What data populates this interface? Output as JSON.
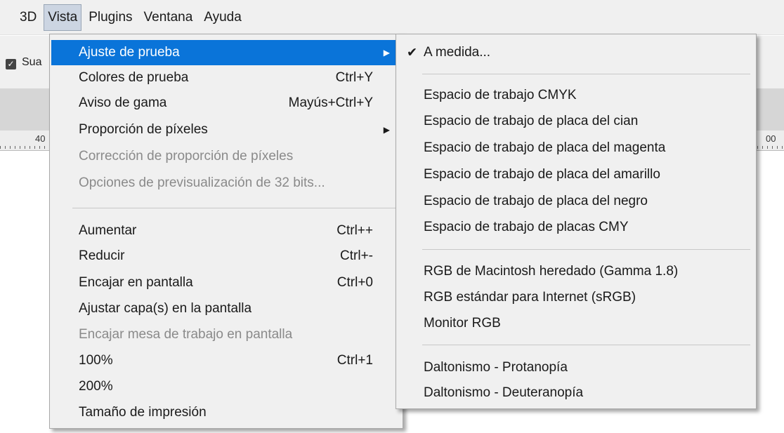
{
  "menubar": {
    "items": [
      "3D",
      "Vista",
      "Plugins",
      "Ventana",
      "Ayuda"
    ],
    "active": "Vista"
  },
  "options_bar": {
    "label": "Sua"
  },
  "ruler": {
    "left_number": "40",
    "right_number": "00"
  },
  "view_menu": {
    "items": [
      {
        "label": "Ajuste de prueba",
        "shortcut": "",
        "submenu": true,
        "state": "highlighted"
      },
      {
        "label": "Colores de prueba",
        "shortcut": "Ctrl+Y"
      },
      {
        "label": "Aviso de gama",
        "shortcut": "Mayús+Ctrl+Y"
      },
      {
        "label": "Proporción de píxeles",
        "shortcut": "",
        "submenu": true
      },
      {
        "label": "Corrección de proporción de píxeles",
        "shortcut": "",
        "state": "disabled"
      },
      {
        "label": "Opciones de previsualización de 32 bits...",
        "shortcut": "",
        "state": "disabled"
      },
      {
        "label": "Aumentar",
        "shortcut": "Ctrl++"
      },
      {
        "label": "Reducir",
        "shortcut": "Ctrl+-"
      },
      {
        "label": "Encajar en pantalla",
        "shortcut": "Ctrl+0"
      },
      {
        "label": "Ajustar capa(s) en la pantalla",
        "shortcut": ""
      },
      {
        "label": "Encajar mesa de trabajo en pantalla",
        "shortcut": "",
        "state": "disabled"
      },
      {
        "label": "100%",
        "shortcut": "Ctrl+1"
      },
      {
        "label": "200%",
        "shortcut": ""
      },
      {
        "label": "Tamaño de impresión",
        "shortcut": ""
      }
    ],
    "arrow_glyph": "▶"
  },
  "proof_setup_submenu": {
    "check_glyph": "✔",
    "items": [
      {
        "label": "A medida...",
        "checked": true
      },
      {
        "label": "Espacio de trabajo CMYK"
      },
      {
        "label": "Espacio de trabajo de placa del cian"
      },
      {
        "label": "Espacio de trabajo de placa del magenta"
      },
      {
        "label": "Espacio de trabajo de placa del amarillo"
      },
      {
        "label": "Espacio de trabajo de placa del negro"
      },
      {
        "label": "Espacio de trabajo de placas CMY"
      },
      {
        "label": "RGB de Macintosh heredado (Gamma 1.8)"
      },
      {
        "label": "RGB estándar para Internet (sRGB)"
      },
      {
        "label": "Monitor RGB"
      },
      {
        "label": "Daltonismo - Protanopía"
      },
      {
        "label": "Daltonismo - Deuteranopía"
      }
    ]
  },
  "colors": {
    "highlight": "#0a74d9",
    "menu_bg": "#f0f0f0",
    "disabled_text": "#8a8a8a"
  }
}
